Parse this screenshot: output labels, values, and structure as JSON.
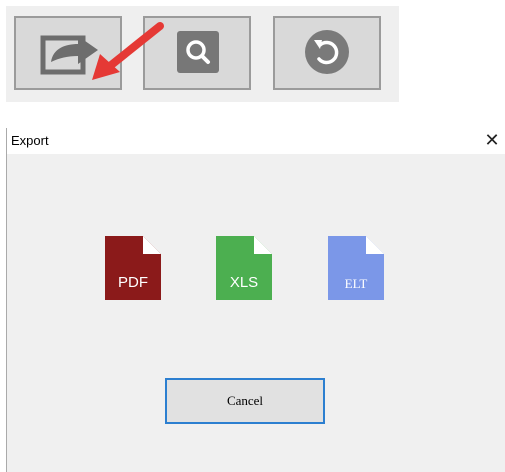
{
  "toolbar": {
    "buttons": [
      {
        "name": "export",
        "icon": "export-icon"
      },
      {
        "name": "search",
        "icon": "search-icon"
      },
      {
        "name": "undo",
        "icon": "undo-icon"
      }
    ],
    "pointer_color": "#e53935"
  },
  "dialog": {
    "title": "Export",
    "close_glyph": "✕",
    "formats": [
      {
        "label": "PDF",
        "color": "#8b1a1a"
      },
      {
        "label": "XLS",
        "color": "#4caf50"
      },
      {
        "label": "ELT",
        "color": "#7b97e8"
      }
    ],
    "cancel_label": "Cancel"
  }
}
